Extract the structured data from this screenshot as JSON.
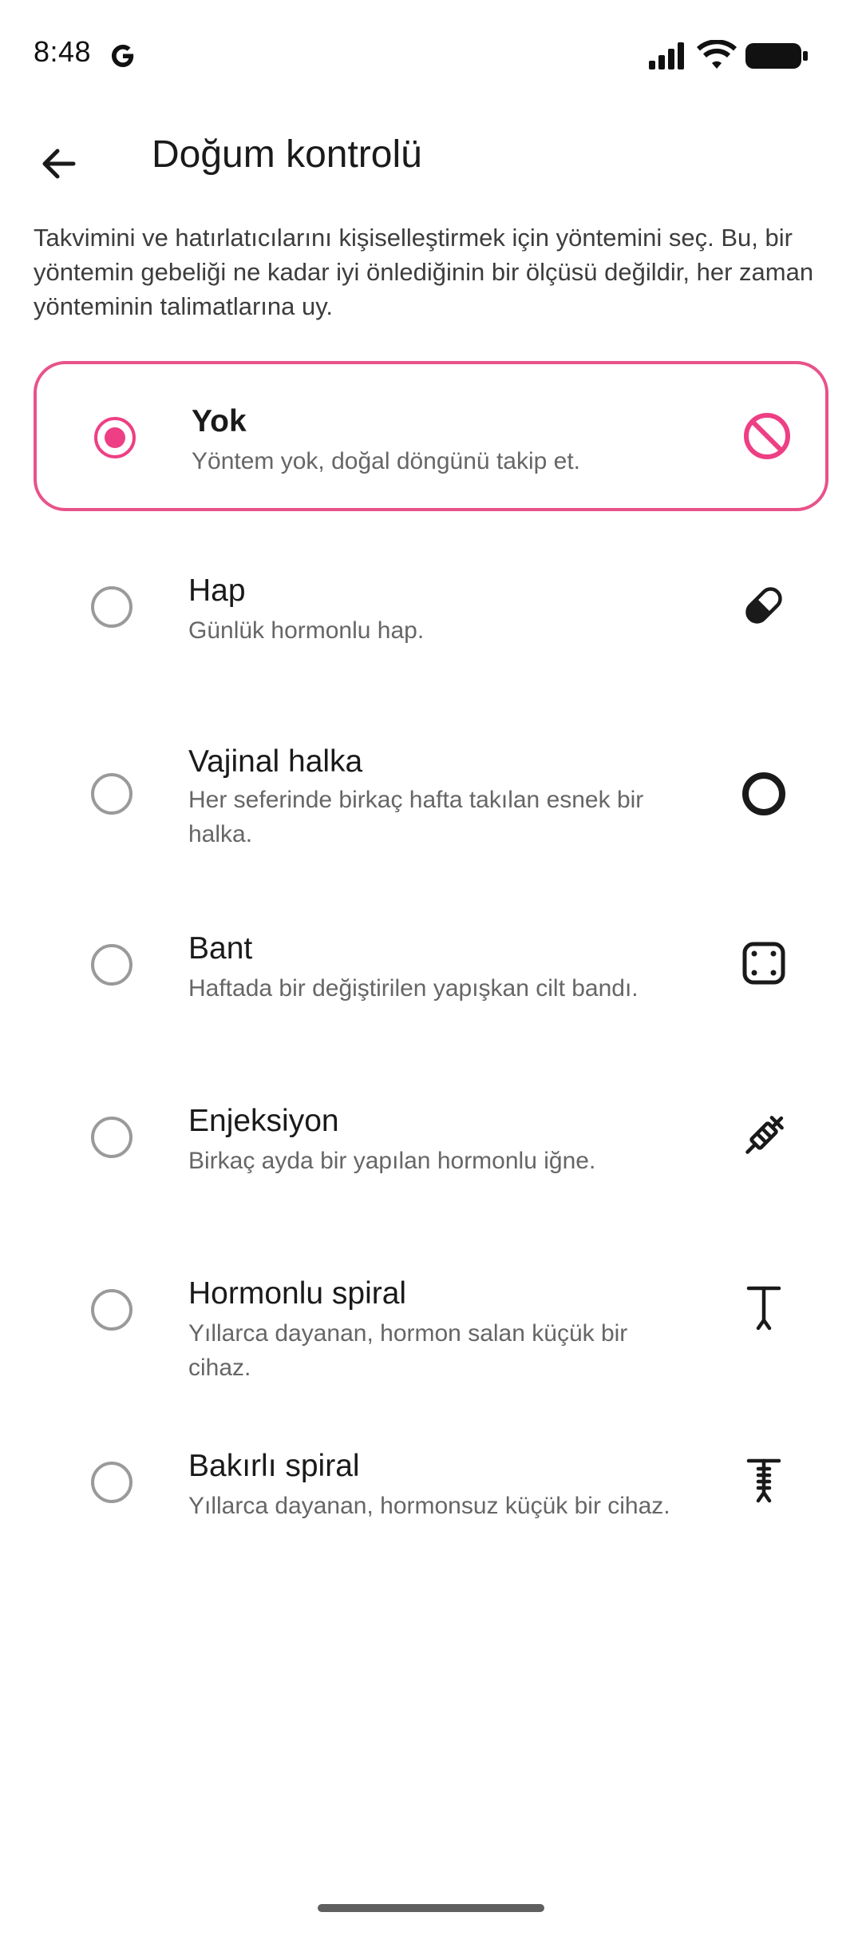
{
  "status_bar": {
    "time": "8:48",
    "icons": [
      "google-g-icon",
      "cell-signal-icon",
      "wifi-icon",
      "battery-icon"
    ]
  },
  "app_bar": {
    "back_icon": "arrow-back-icon",
    "title": "Doğum kontrolü"
  },
  "description": "Takvimini ve hatırlatıcılarını kişiselleştirmek için yöntemini seç. Bu, bir yöntemin gebeliği ne kadar iyi önlediğinin bir ölçüsü değildir,  her zaman yönteminin talimatlarına uy.",
  "colors": {
    "accent": "#ee3f84",
    "selected_border": "#e8528a",
    "radio_off": "#9a9a9a",
    "text_primary": "#1a1a1a",
    "text_secondary": "#666666"
  },
  "options": [
    {
      "title": "Yok",
      "description": "Yöntem yok,  doğal döngünü takip et.",
      "icon": "no-symbol-icon",
      "selected": true
    },
    {
      "title": "Hap",
      "description": "Günlük hormonlu hap.",
      "icon": "pill-icon",
      "selected": false
    },
    {
      "title": "Vajinal halka",
      "description": "Her seferinde birkaç hafta takılan esnek bir halka.",
      "icon": "ring-icon",
      "selected": false
    },
    {
      "title": "Bant",
      "description": "Haftada bir değiştirilen yapışkan cilt bandı.",
      "icon": "patch-icon",
      "selected": false
    },
    {
      "title": "Enjeksiyon",
      "description": "Birkaç ayda bir yapılan hormonlu iğne.",
      "icon": "syringe-icon",
      "selected": false
    },
    {
      "title": "Hormonlu spiral",
      "description": "Yıllarca dayanan, hormon salan küçük bir cihaz.",
      "icon": "hormonal-iud-icon",
      "selected": false
    },
    {
      "title": "Bakırlı spiral",
      "description": "Yıllarca dayanan, hormonsuz küçük bir cihaz.",
      "icon": "copper-iud-icon",
      "selected": false
    }
  ]
}
